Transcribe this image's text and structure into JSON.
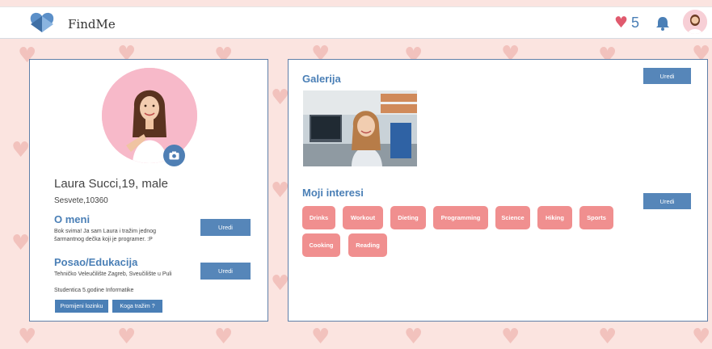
{
  "app": {
    "name": "FindMe"
  },
  "header": {
    "likes_count": "5",
    "heart_icon": "heart-icon",
    "bell_icon": "bell-icon"
  },
  "profile": {
    "name_line": "Laura Succi,19, male",
    "location": "Sesvete,10360",
    "about_title": "O meni",
    "about_text_1": "Bok svima! Ja sam Laura i tražim jednog",
    "about_text_2": "šarmantnog dečka koji je programer. :P",
    "about_edit": "Uredi",
    "work_title": "Posao/Edukacija",
    "work_text": "Tehničko Veleučilište Zagreb, Sveučilište u Puli",
    "work_edit": "Uredi",
    "study_text": "Studentica 5.godine Informatike",
    "change_password": "Promijeni lozinku",
    "looking_for": "Koga tražim ?"
  },
  "gallery": {
    "title": "Galerija",
    "edit": "Uredi"
  },
  "interests": {
    "title": "Moji interesi",
    "edit": "Uredi",
    "items": [
      "Drinks",
      "Workout",
      "Dieting",
      "Programming",
      "Science",
      "Hiking",
      "Sports",
      "Cooking",
      "Reading"
    ]
  },
  "colors": {
    "accent": "#4a7fb6",
    "tag": "#f08f8f",
    "background": "#fbe4e0"
  }
}
